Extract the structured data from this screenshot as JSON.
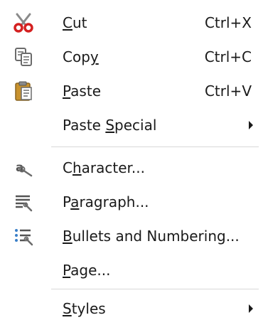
{
  "menu": {
    "items": [
      {
        "id": "cut",
        "pre": "",
        "mnemonic": "C",
        "post": "ut",
        "shortcut": "Ctrl+X",
        "icon": "scissors-icon",
        "submenu": false
      },
      {
        "id": "copy",
        "pre": "Cop",
        "mnemonic": "y",
        "post": "",
        "shortcut": "Ctrl+C",
        "icon": "copy-icon",
        "submenu": false
      },
      {
        "id": "paste",
        "pre": "",
        "mnemonic": "P",
        "post": "aste",
        "shortcut": "Ctrl+V",
        "icon": "clipboard-icon",
        "submenu": false
      },
      {
        "id": "paste-special",
        "pre": "Paste ",
        "mnemonic": "S",
        "post": "pecial",
        "shortcut": "",
        "icon": "",
        "submenu": true
      },
      {
        "id": "character",
        "pre": "C",
        "mnemonic": "h",
        "post": "aracter...",
        "shortcut": "",
        "icon": "character-format-icon",
        "submenu": false
      },
      {
        "id": "paragraph",
        "pre": "P",
        "mnemonic": "a",
        "post": "ragraph...",
        "shortcut": "",
        "icon": "paragraph-format-icon",
        "submenu": false
      },
      {
        "id": "bullets",
        "pre": "",
        "mnemonic": "B",
        "post": "ullets and Numbering...",
        "shortcut": "",
        "icon": "bullets-numbering-icon",
        "submenu": false
      },
      {
        "id": "page",
        "pre": "",
        "mnemonic": "P",
        "post": "age...",
        "shortcut": "",
        "icon": "",
        "submenu": false
      },
      {
        "id": "styles",
        "pre": "",
        "mnemonic": "S",
        "post": "tyles",
        "shortcut": "",
        "icon": "",
        "submenu": true
      }
    ]
  },
  "colors": {
    "text": "#1a1a1a",
    "scissors_red": "#d42020",
    "scissors_blade": "#8a8a8a",
    "icon_gray": "#6b6b6b",
    "clipboard_brown": "#c8922e",
    "bullet_blue": "#3a7fc8"
  }
}
